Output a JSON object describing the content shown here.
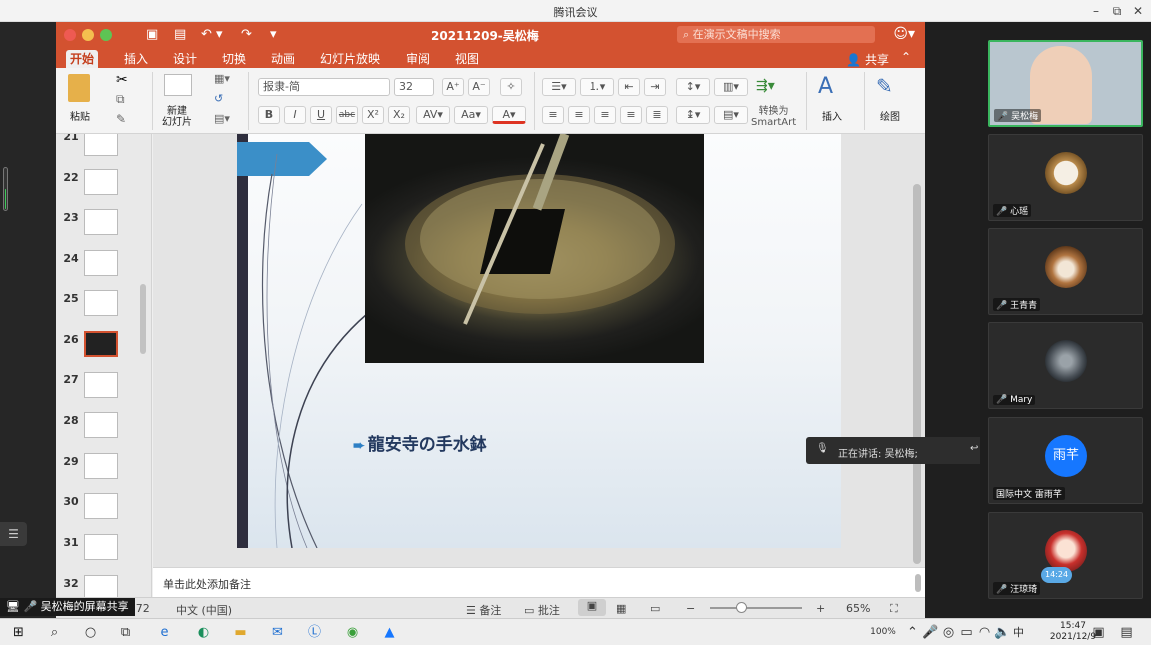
{
  "meeting": {
    "title": "腾讯会议",
    "minimize": "–",
    "restore": "⧉",
    "close": "✕"
  },
  "ppt": {
    "doc_title": "20211209-吴松梅",
    "search_placeholder": "在演示文稿中搜索",
    "tabs": [
      {
        "label": "开始",
        "active": true
      },
      {
        "label": "插入"
      },
      {
        "label": "设计"
      },
      {
        "label": "切换"
      },
      {
        "label": "动画"
      },
      {
        "label": "幻灯片放映"
      },
      {
        "label": "审阅"
      },
      {
        "label": "视图"
      }
    ],
    "share_label": "共享",
    "ribbon": {
      "paste": "粘贴",
      "new_slide": "新建\n幻灯片",
      "font_name": "报隶-简",
      "font_size": "32",
      "convert": "转换为\nSmartArt",
      "insert": "插入",
      "draw": "绘图"
    },
    "thumb_numbers": [
      "21",
      "22",
      "23",
      "24",
      "25",
      "26",
      "27",
      "28",
      "29",
      "30",
      "31",
      "32"
    ],
    "selected_slide": "26",
    "slide": {
      "caption": "龍安寺の手水鉢"
    },
    "notes_placeholder": "单击此处添加备注",
    "status": {
      "slide_count": "6 / 72",
      "language": "中文 (中国)",
      "notes": "备注",
      "comments": "批注",
      "zoom": "65%"
    }
  },
  "share_badge": "吴松梅的屏幕共享",
  "participants": [
    {
      "name": "吴松梅",
      "active": true
    },
    {
      "name": "心瑶"
    },
    {
      "name": "王青青"
    },
    {
      "name": "Mary"
    },
    {
      "name": "国际中文 雷雨芊",
      "avatar_text": "雨芊"
    },
    {
      "name": "汪琼琦",
      "badge": "14:24"
    }
  ],
  "speaking": "正在讲话: 吴松梅;",
  "taskbar": {
    "time": "15:47",
    "date": "2021/12/9",
    "battery": "100%",
    "ime": "中"
  }
}
